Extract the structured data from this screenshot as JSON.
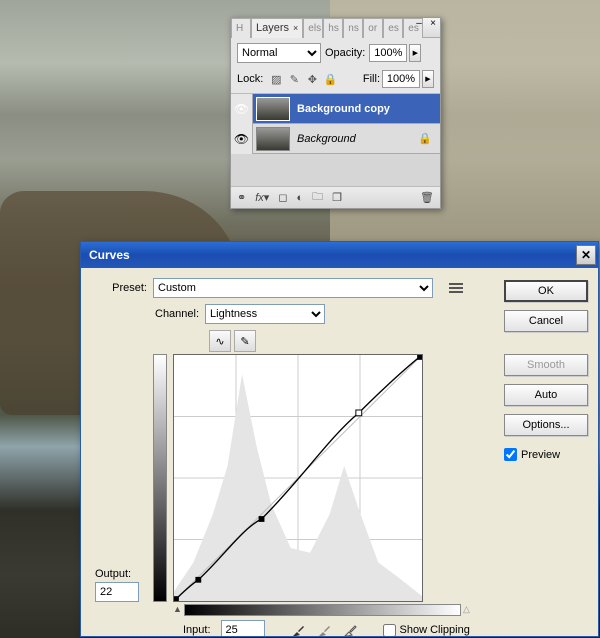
{
  "panel": {
    "tabs": [
      "H",
      "Layers",
      "els",
      "hs",
      "ns",
      "or",
      "es",
      "es"
    ],
    "active_tab": "Layers",
    "blend_mode": "Normal",
    "opacity_label": "Opacity:",
    "opacity_value": "100%",
    "fill_label": "Fill:",
    "fill_value": "100%",
    "lock_label": "Lock:",
    "layers": [
      {
        "name": "Background copy",
        "visible": true,
        "locked": false,
        "selected": true
      },
      {
        "name": "Background",
        "visible": true,
        "locked": true,
        "selected": false
      }
    ]
  },
  "curves": {
    "title": "Curves",
    "preset_label": "Preset:",
    "preset_value": "Custom",
    "channel_label": "Channel:",
    "channel_value": "Lightness",
    "output_label": "Output:",
    "output_value": "22",
    "input_label": "Input:",
    "input_value": "25",
    "show_clipping_label": "Show Clipping",
    "buttons": {
      "ok": "OK",
      "cancel": "Cancel",
      "smooth": "Smooth",
      "auto": "Auto",
      "options": "Options..."
    },
    "preview_label": "Preview",
    "preview_checked": true
  },
  "chart_data": {
    "type": "line",
    "title": "Curves",
    "xlabel": "Input",
    "ylabel": "Output",
    "xlim": [
      0,
      255
    ],
    "ylim": [
      0,
      255
    ],
    "curve_points": [
      {
        "x": 0,
        "y": 0
      },
      {
        "x": 25,
        "y": 22
      },
      {
        "x": 90,
        "y": 85
      },
      {
        "x": 190,
        "y": 195
      },
      {
        "x": 255,
        "y": 255
      }
    ],
    "control_points": [
      {
        "x": 25,
        "y": 22
      },
      {
        "x": 90,
        "y": 85
      },
      {
        "x": 190,
        "y": 195
      }
    ],
    "histogram_approx": [
      {
        "x": 0,
        "y": 10
      },
      {
        "x": 20,
        "y": 40
      },
      {
        "x": 40,
        "y": 90
      },
      {
        "x": 55,
        "y": 140
      },
      {
        "x": 70,
        "y": 235
      },
      {
        "x": 85,
        "y": 160
      },
      {
        "x": 100,
        "y": 100
      },
      {
        "x": 120,
        "y": 55
      },
      {
        "x": 140,
        "y": 50
      },
      {
        "x": 160,
        "y": 90
      },
      {
        "x": 175,
        "y": 140
      },
      {
        "x": 190,
        "y": 95
      },
      {
        "x": 210,
        "y": 40
      },
      {
        "x": 230,
        "y": 25
      },
      {
        "x": 255,
        "y": 5
      }
    ]
  }
}
